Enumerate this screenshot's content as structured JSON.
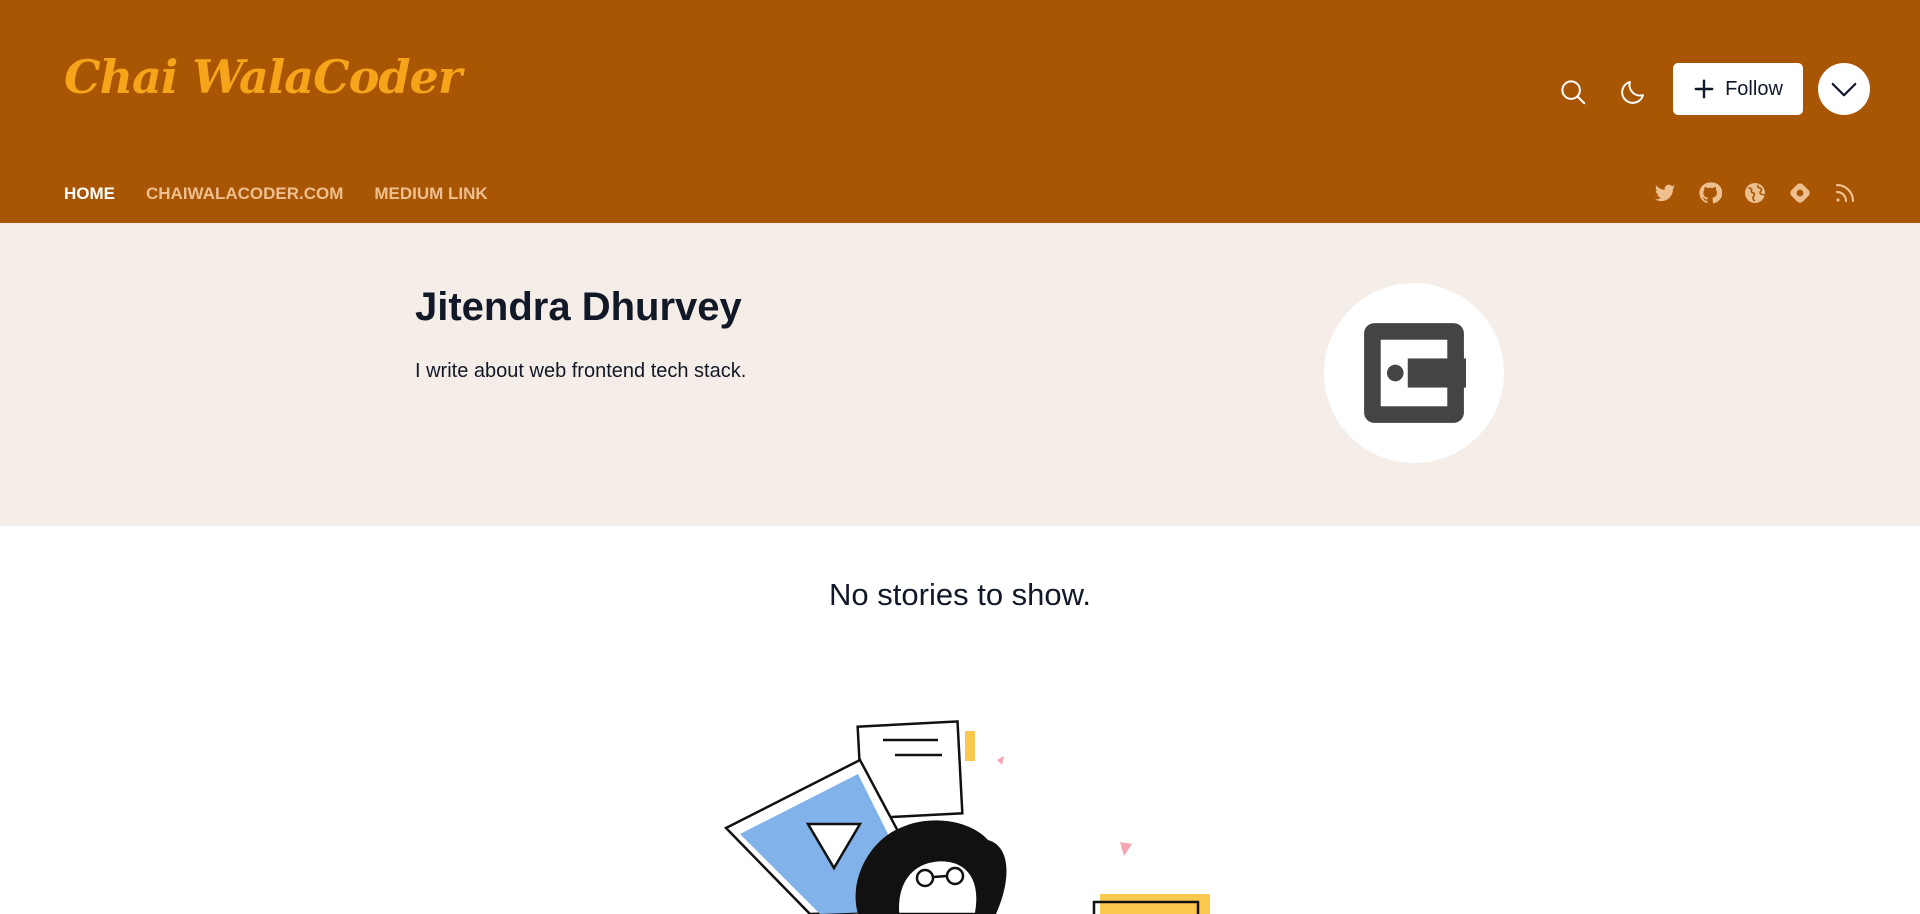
{
  "blog": {
    "logo_text": "Chai WalaCoder"
  },
  "header": {
    "icons": [
      "search-icon",
      "moon-icon",
      "plus-icon",
      "chevron-down-icon"
    ],
    "follow_label": "Follow",
    "colors": {
      "header_bg": "#a85504",
      "logo": "#f6a41a",
      "nav_inactive": "#eebf8f",
      "profile_bg": "#f5ede7"
    }
  },
  "nav": {
    "items": [
      {
        "label": "HOME",
        "active": true
      },
      {
        "label": "CHAIWALACODER.COM",
        "active": false
      },
      {
        "label": "MEDIUM LINK",
        "active": false
      }
    ],
    "social_icons": [
      "twitter-icon",
      "github-icon",
      "globe-icon",
      "hashnode-icon",
      "rss-icon"
    ]
  },
  "profile": {
    "name": "Jitendra Dhurvey",
    "bio": "I write about web frontend tech stack."
  },
  "feed": {
    "empty_message": "No stories to show."
  }
}
